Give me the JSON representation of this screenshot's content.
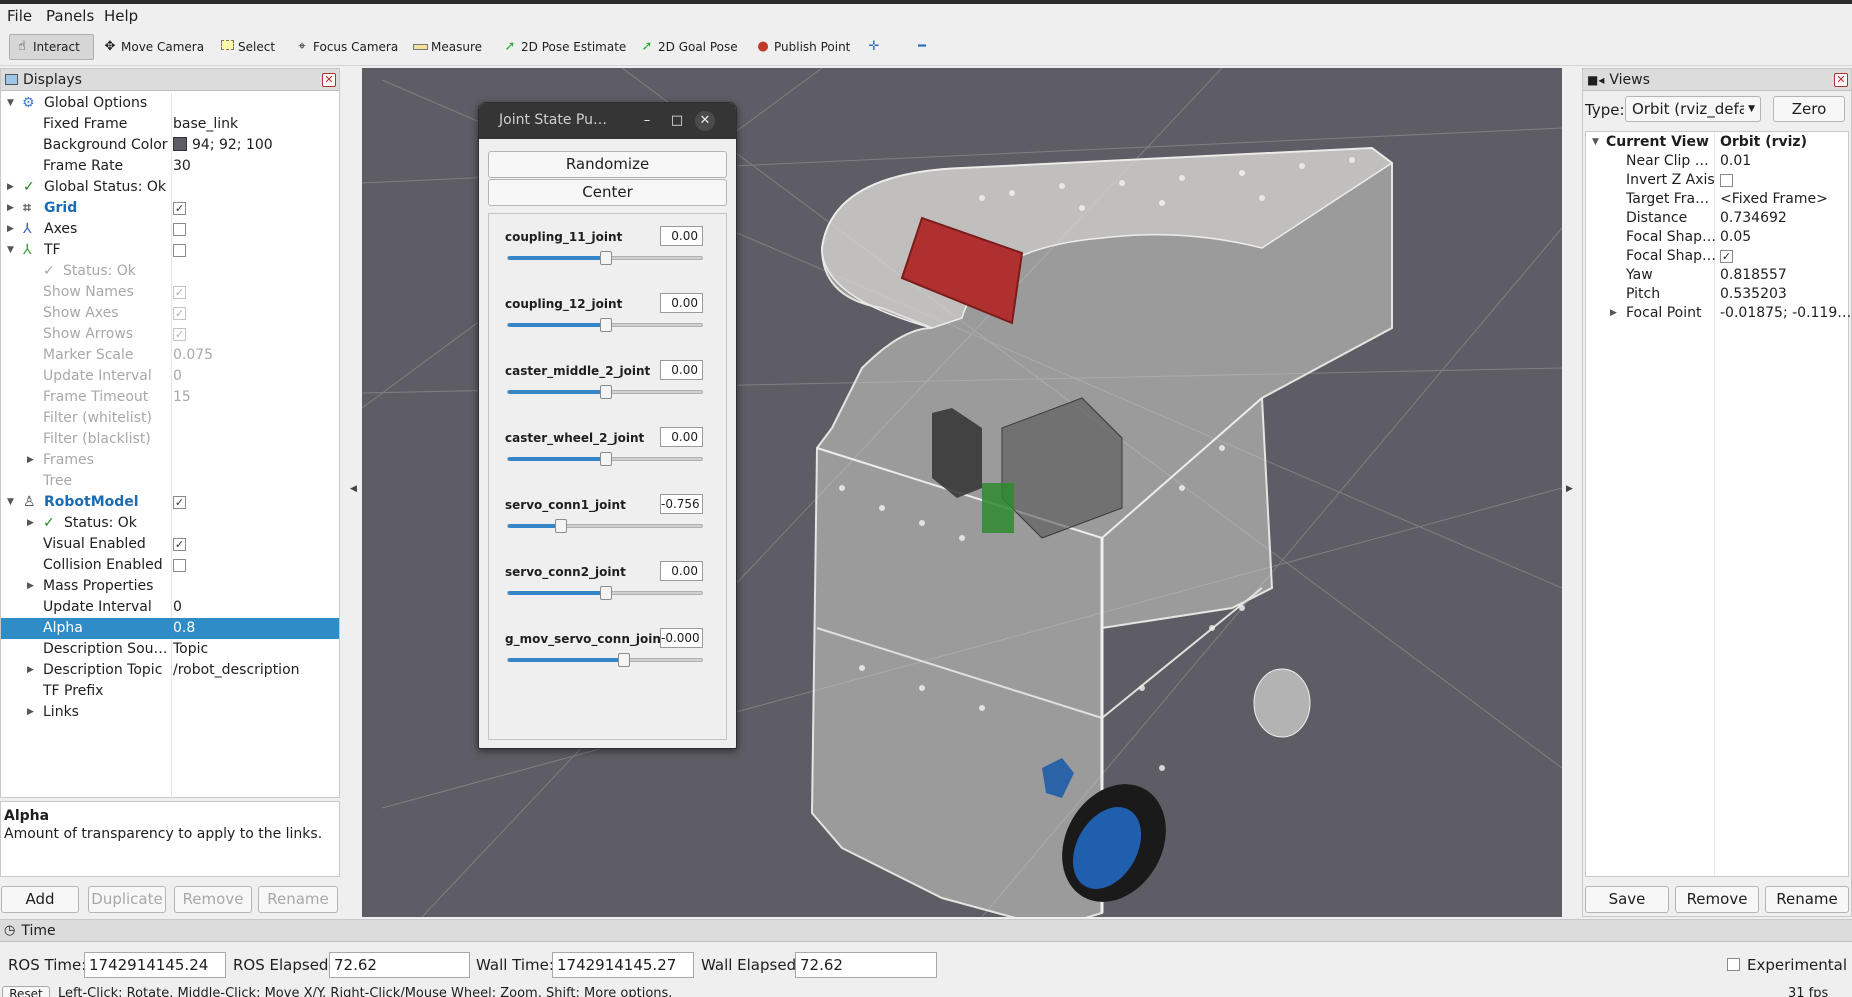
{
  "menu": [
    "File",
    "Panels",
    "Help"
  ],
  "toolbar": {
    "interact": "Interact",
    "move_camera": "Move Camera",
    "select": "Select",
    "focus_camera": "Focus Camera",
    "measure": "Measure",
    "pose_estimate": "2D Pose Estimate",
    "goal_pose": "2D Goal Pose",
    "publish_point": "Publish Point"
  },
  "displays": {
    "title": "Displays",
    "rows": [
      {
        "label": "Global Options"
      },
      {
        "label": "Fixed Frame",
        "value": "base_link"
      },
      {
        "label": "Background Color",
        "value": "94; 92; 100"
      },
      {
        "label": "Frame Rate",
        "value": "30"
      },
      {
        "label": "Global Status: Ok"
      },
      {
        "label": "Grid"
      },
      {
        "label": "Axes"
      },
      {
        "label": "TF"
      },
      {
        "label": "Status: Ok"
      },
      {
        "label": "Show Names"
      },
      {
        "label": "Show Axes"
      },
      {
        "label": "Show Arrows"
      },
      {
        "label": "Marker Scale",
        "value": "0.075"
      },
      {
        "label": "Update Interval",
        "value": "0"
      },
      {
        "label": "Frame Timeout",
        "value": "15"
      },
      {
        "label": "Filter (whitelist)"
      },
      {
        "label": "Filter (blacklist)"
      },
      {
        "label": "Frames"
      },
      {
        "label": "Tree"
      },
      {
        "label": "RobotModel"
      },
      {
        "label": "Status: Ok"
      },
      {
        "label": "Visual Enabled"
      },
      {
        "label": "Collision Enabled"
      },
      {
        "label": "Mass Properties"
      },
      {
        "label": "Update Interval",
        "value": "0"
      },
      {
        "label": "Alpha",
        "value": "0.8"
      },
      {
        "label": "Description Sou…",
        "value": "Topic"
      },
      {
        "label": "Description Topic",
        "value": "/robot_description"
      },
      {
        "label": "TF Prefix"
      },
      {
        "label": "Links"
      }
    ],
    "help_title": "Alpha",
    "help_text": "Amount of transparency to apply to the links.",
    "buttons": {
      "add": "Add",
      "duplicate": "Duplicate",
      "remove": "Remove",
      "rename": "Rename"
    }
  },
  "joint_dialog": {
    "title": "Joint State Pu…",
    "randomize": "Randomize",
    "center": "Center",
    "joints": [
      {
        "name": "coupling_11_joint",
        "value": "0.00",
        "fraction": 0.5
      },
      {
        "name": "coupling_12_joint",
        "value": "0.00",
        "fraction": 0.5
      },
      {
        "name": "caster_middle_2_joint",
        "value": "0.00",
        "fraction": 0.5
      },
      {
        "name": "caster_wheel_2_joint",
        "value": "0.00",
        "fraction": 0.5
      },
      {
        "name": "servo_conn1_joint",
        "value": "-0.756",
        "fraction": 0.27
      },
      {
        "name": "servo_conn2_joint",
        "value": "0.00",
        "fraction": 0.5
      },
      {
        "name": "g_mov_servo_conn_joint",
        "value": "-0.000",
        "fraction": 0.59
      }
    ]
  },
  "views": {
    "title": "Views",
    "type_label": "Type:",
    "type_value": "Orbit (rviz_defau",
    "zero": "Zero",
    "current_view": "Current View",
    "current_view_value": "Orbit (rviz)",
    "rows": [
      {
        "label": "Near Clip …",
        "value": "0.01"
      },
      {
        "label": "Invert Z Axis"
      },
      {
        "label": "Target Fra…",
        "value": "<Fixed Frame>"
      },
      {
        "label": "Distance",
        "value": "0.734692"
      },
      {
        "label": "Focal Shap…",
        "value": "0.05"
      },
      {
        "label": "Focal Shap…"
      },
      {
        "label": "Yaw",
        "value": "0.818557"
      },
      {
        "label": "Pitch",
        "value": "0.535203"
      },
      {
        "label": "Focal Point",
        "value": "-0.01875; -0.119…"
      }
    ],
    "buttons": {
      "save": "Save",
      "remove": "Remove",
      "rename": "Rename"
    }
  },
  "time": {
    "title": "Time",
    "ros_time_label": "ROS Time:",
    "ros_time": "1742914145.24",
    "ros_elapsed_label": "ROS Elapsed:",
    "ros_elapsed": "72.62",
    "wall_time_label": "Wall Time:",
    "wall_time": "1742914145.27",
    "wall_elapsed_label": "Wall Elapsed:",
    "wall_elapsed": "72.62",
    "experimental": "Experimental"
  },
  "status": {
    "reset": "Reset",
    "hint": "Left-Click: Rotate.  Middle-Click: Move X/Y.  Right-Click/Mouse Wheel: Zoom.  Shift: More options.",
    "fps": "31 fps"
  },
  "colors": {
    "viewport_bg": "#5e5c64",
    "selection": "#308cc6",
    "accent": "#3586c8"
  }
}
